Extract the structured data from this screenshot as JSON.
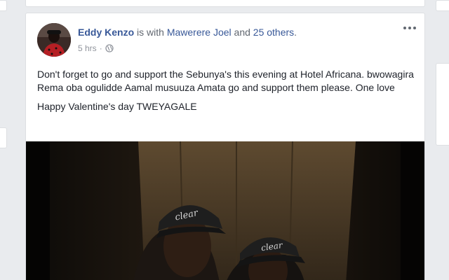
{
  "post": {
    "author": "Eddy Kenzo",
    "with_prefix": " is with ",
    "tagged_person": "Mawerere Joel",
    "and_text": " and ",
    "others_link": "25 others",
    "period": ".",
    "timestamp": "5 hrs",
    "separator": "·",
    "privacy_icon": "globe-icon",
    "options_icon": "more-options-icon",
    "paragraphs": [
      "Don't forget to go and support the Sebunya's this evening at Hotel Africana. bwowagira Rema oba ogulidde Aamal musuuza Amata go and support them please. One love",
      "Happy Valentine's day TWEYAGALE"
    ]
  },
  "colors": {
    "link": "#385898",
    "text": "#1d2129",
    "meta": "#90949c",
    "background": "#e9ebee"
  }
}
